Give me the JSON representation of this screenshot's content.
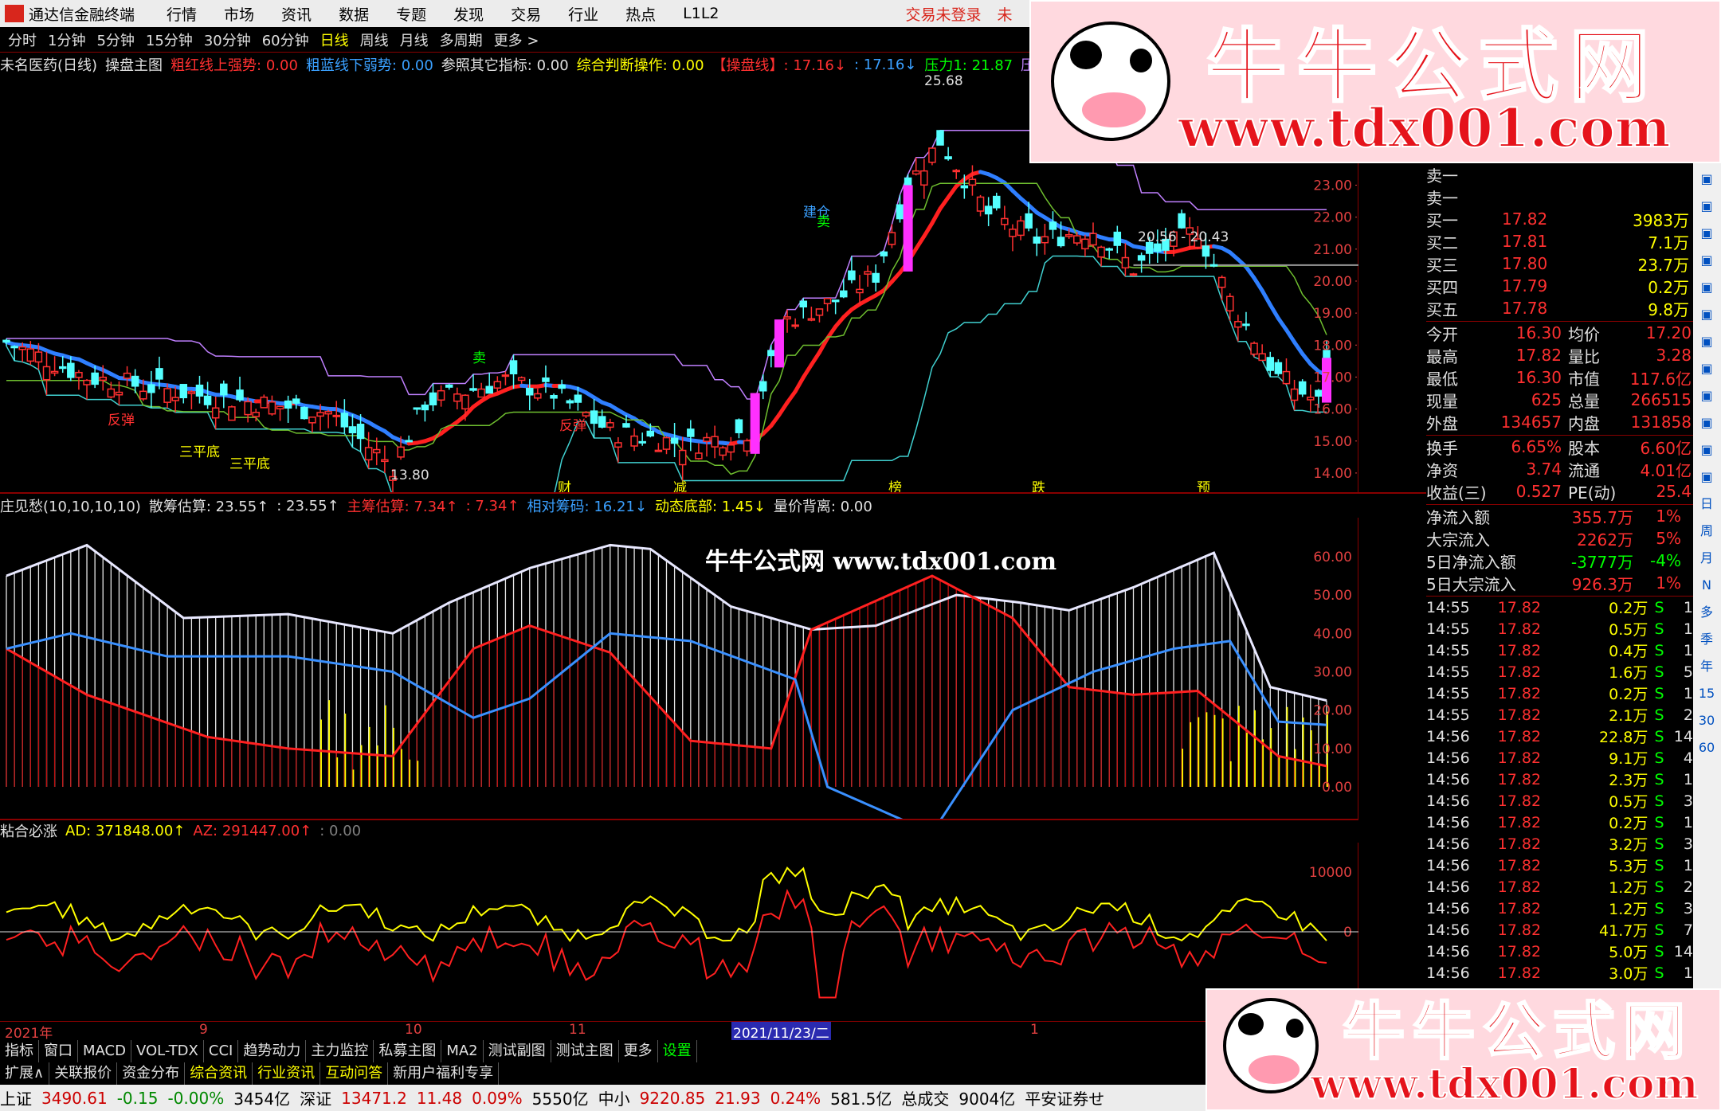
{
  "menubar": {
    "app_name": "通达信金融终端",
    "items": [
      "行情",
      "市场",
      "资讯",
      "数据",
      "专题",
      "发现",
      "交易",
      "行业",
      "热点",
      "L1L2"
    ],
    "login": "交易未登录",
    "login_extra": "未"
  },
  "periods": [
    "分时",
    "1分钟",
    "5分钟",
    "15分钟",
    "30分钟",
    "60分钟",
    "日线",
    "周线",
    "月线",
    "多周期",
    "更多 >"
  ],
  "active_period": "日线",
  "main_indicator": {
    "stock": "未名医药(日线)",
    "name": "操盘主图",
    "items": [
      {
        "label": "粗红线上强势: 0.00",
        "color": "#ff3030"
      },
      {
        "label": "粗蓝线下弱势: 0.00",
        "color": "#3aa0ff"
      },
      {
        "label": "参照其它指标: 0.00",
        "color": "#e0e0e0"
      },
      {
        "label": "综合判断操作: 0.00",
        "color": "#ffff00"
      },
      {
        "label": "【操盘线】: 17.16↓",
        "color": "#ff3030"
      },
      {
        "label": ": 17.16↓",
        "color": "#3aa0ff"
      },
      {
        "label": "压力1: 21.87",
        "color": "#00ff00"
      },
      {
        "label": "压力",
        "color": "#c080ff"
      }
    ],
    "y_ticks": [
      "23.00",
      "22.00",
      "21.00",
      "20.00",
      "19.00",
      "18.00",
      "17.00",
      "16.00",
      "15.00",
      "14.00"
    ],
    "annotations": {
      "high": "25.68",
      "low": "13.80",
      "range": "20.56 - 20.43",
      "events": [
        "财",
        "减",
        "榜",
        "跌",
        "预"
      ],
      "signals": [
        "反弹",
        "三平底",
        "三平底",
        "卖",
        "反弹",
        "建仓",
        "卖"
      ]
    }
  },
  "chip_indicator": {
    "name": "庄见愁(10,10,10,10)",
    "items": [
      {
        "label": "散筹估算: 23.55↑",
        "color": "#e0e0e0"
      },
      {
        "label": ": 23.55↑",
        "color": "#e0e0e0"
      },
      {
        "label": "主筹估算: 7.34↑",
        "color": "#ff3030"
      },
      {
        "label": ": 7.34↑",
        "color": "#ff3030"
      },
      {
        "label": "相对筹码: 16.21↓",
        "color": "#3aa0ff"
      },
      {
        "label": "动态底部: 1.45↓",
        "color": "#ffff00"
      },
      {
        "label": "量价背离: 0.00",
        "color": "#e0e0e0"
      }
    ],
    "y_ticks": [
      "60.00",
      "50.00",
      "40.00",
      "30.00",
      "20.00",
      "10.00",
      "0.00"
    ]
  },
  "ad_indicator": {
    "name": "粘合必涨",
    "items": [
      {
        "label": "AD: 371848.00↑",
        "color": "#ffff00"
      },
      {
        "label": "AZ: 291447.00↑",
        "color": "#ff3030"
      },
      {
        "label": ": 0.00",
        "color": "#808080"
      }
    ],
    "y_ticks": [
      "10000",
      "0"
    ]
  },
  "time_axis": {
    "labels": [
      "2021年",
      "9",
      "10",
      "11",
      "2021/11/23/二",
      "1"
    ]
  },
  "tabs1": [
    "指标",
    "窗口",
    "MACD",
    "VOL-TDX",
    "CCI",
    "趋势动力",
    "主力监控",
    "私募主图",
    "MA2",
    "测试副图",
    "测试主图",
    "更多",
    "设置"
  ],
  "tabs2": [
    "扩展∧",
    "关联报价",
    "资金分布",
    "综合资讯",
    "行业资讯",
    "互动问答",
    "新用户福利专享"
  ],
  "statusbar": [
    {
      "t": "上证",
      "c": "#000"
    },
    {
      "t": "3490.61",
      "c": "#c00"
    },
    {
      "t": "-0.15",
      "c": "#080"
    },
    {
      "t": "-0.00%",
      "c": "#080"
    },
    {
      "t": "3454亿",
      "c": "#000"
    },
    {
      "t": "深证",
      "c": "#000"
    },
    {
      "t": "13471.2",
      "c": "#c00"
    },
    {
      "t": "11.48",
      "c": "#c00"
    },
    {
      "t": "0.09%",
      "c": "#c00"
    },
    {
      "t": "5550亿",
      "c": "#000"
    },
    {
      "t": "中小",
      "c": "#000"
    },
    {
      "t": "9220.85",
      "c": "#c00"
    },
    {
      "t": "21.93",
      "c": "#c00"
    },
    {
      "t": "0.24%",
      "c": "#c00"
    },
    {
      "t": "581.5亿",
      "c": "#000"
    },
    {
      "t": "总成交",
      "c": "#000"
    },
    {
      "t": "9004亿",
      "c": "#000"
    },
    {
      "t": "平安证券せ",
      "c": "#000"
    }
  ],
  "quote": {
    "sell": [
      {
        "l": "卖一"
      },
      {
        "l": "卖一"
      }
    ],
    "buy": [
      {
        "l": "买一",
        "p": "17.82",
        "v": "3983万"
      },
      {
        "l": "买二",
        "p": "17.81",
        "v": "7.1万"
      },
      {
        "l": "买三",
        "p": "17.80",
        "v": "23.7万"
      },
      {
        "l": "买四",
        "p": "17.79",
        "v": "0.2万"
      },
      {
        "l": "买五",
        "p": "17.78",
        "v": "9.8万"
      }
    ],
    "stats": [
      {
        "a": "今开",
        "av": "16.30",
        "b": "均价",
        "bv": "17.20"
      },
      {
        "a": "最高",
        "av": "17.82",
        "b": "量比",
        "bv": "3.28"
      },
      {
        "a": "最低",
        "av": "16.30",
        "b": "市值",
        "bv": "117.6亿"
      },
      {
        "a": "现量",
        "av": "625",
        "b": "总量",
        "bv": "266515"
      },
      {
        "a": "外盘",
        "av": "134657",
        "b": "内盘",
        "bv": "131858"
      }
    ],
    "stats2": [
      {
        "a": "换手",
        "av": "6.65%",
        "b": "股本",
        "bv": "6.60亿"
      },
      {
        "a": "净资",
        "av": "3.74",
        "b": "流通",
        "bv": "4.01亿"
      },
      {
        "a": "收益(三)",
        "av": "0.527",
        "b": "PE(动)",
        "bv": "25.4"
      }
    ],
    "flows": [
      {
        "l": "净流入额",
        "v": "355.7万",
        "p": "1%"
      },
      {
        "l": "大宗流入",
        "v": "2262万",
        "p": "5%"
      },
      {
        "l": "5日净流入额",
        "v": "-3777万",
        "p": "-4%"
      },
      {
        "l": "5日大宗流入",
        "v": "926.3万",
        "p": "1%"
      }
    ],
    "ticks": [
      {
        "t": "14:55",
        "p": "17.82",
        "v": "0.2万",
        "s": "S",
        "n": "1"
      },
      {
        "t": "14:55",
        "p": "17.82",
        "v": "0.5万",
        "s": "S",
        "n": "1"
      },
      {
        "t": "14:55",
        "p": "17.82",
        "v": "0.4万",
        "s": "S",
        "n": "1"
      },
      {
        "t": "14:55",
        "p": "17.82",
        "v": "1.6万",
        "s": "S",
        "n": "5"
      },
      {
        "t": "14:55",
        "p": "17.82",
        "v": "0.2万",
        "s": "S",
        "n": "1"
      },
      {
        "t": "14:55",
        "p": "17.82",
        "v": "2.1万",
        "s": "S",
        "n": "2"
      },
      {
        "t": "14:56",
        "p": "17.82",
        "v": "22.8万",
        "s": "S",
        "n": "14"
      },
      {
        "t": "14:56",
        "p": "17.82",
        "v": "9.1万",
        "s": "S",
        "n": "4"
      },
      {
        "t": "14:56",
        "p": "17.82",
        "v": "2.3万",
        "s": "S",
        "n": "1"
      },
      {
        "t": "14:56",
        "p": "17.82",
        "v": "0.5万",
        "s": "S",
        "n": "3"
      },
      {
        "t": "14:56",
        "p": "17.82",
        "v": "0.2万",
        "s": "S",
        "n": "1"
      },
      {
        "t": "14:56",
        "p": "17.82",
        "v": "3.2万",
        "s": "S",
        "n": "3"
      },
      {
        "t": "14:56",
        "p": "17.82",
        "v": "5.3万",
        "s": "S",
        "n": "1"
      },
      {
        "t": "14:56",
        "p": "17.82",
        "v": "1.2万",
        "s": "S",
        "n": "2"
      },
      {
        "t": "14:56",
        "p": "17.82",
        "v": "1.2万",
        "s": "S",
        "n": "3"
      },
      {
        "t": "14:56",
        "p": "17.82",
        "v": "41.7万",
        "s": "S",
        "n": "7"
      },
      {
        "t": "14:56",
        "p": "17.82",
        "v": "5.0万",
        "s": "S",
        "n": "14"
      },
      {
        "t": "14:56",
        "p": "17.82",
        "v": "3.0万",
        "s": "S",
        "n": "1"
      }
    ]
  },
  "right_toolbar": [
    "日",
    "周",
    "月",
    "N",
    "多",
    "季",
    "年",
    "15",
    "30",
    "60"
  ],
  "banner": {
    "title": "牛牛公式网",
    "url": "www.tdx001.com"
  },
  "watermark": "牛牛公式网 www.tdx001.com"
}
